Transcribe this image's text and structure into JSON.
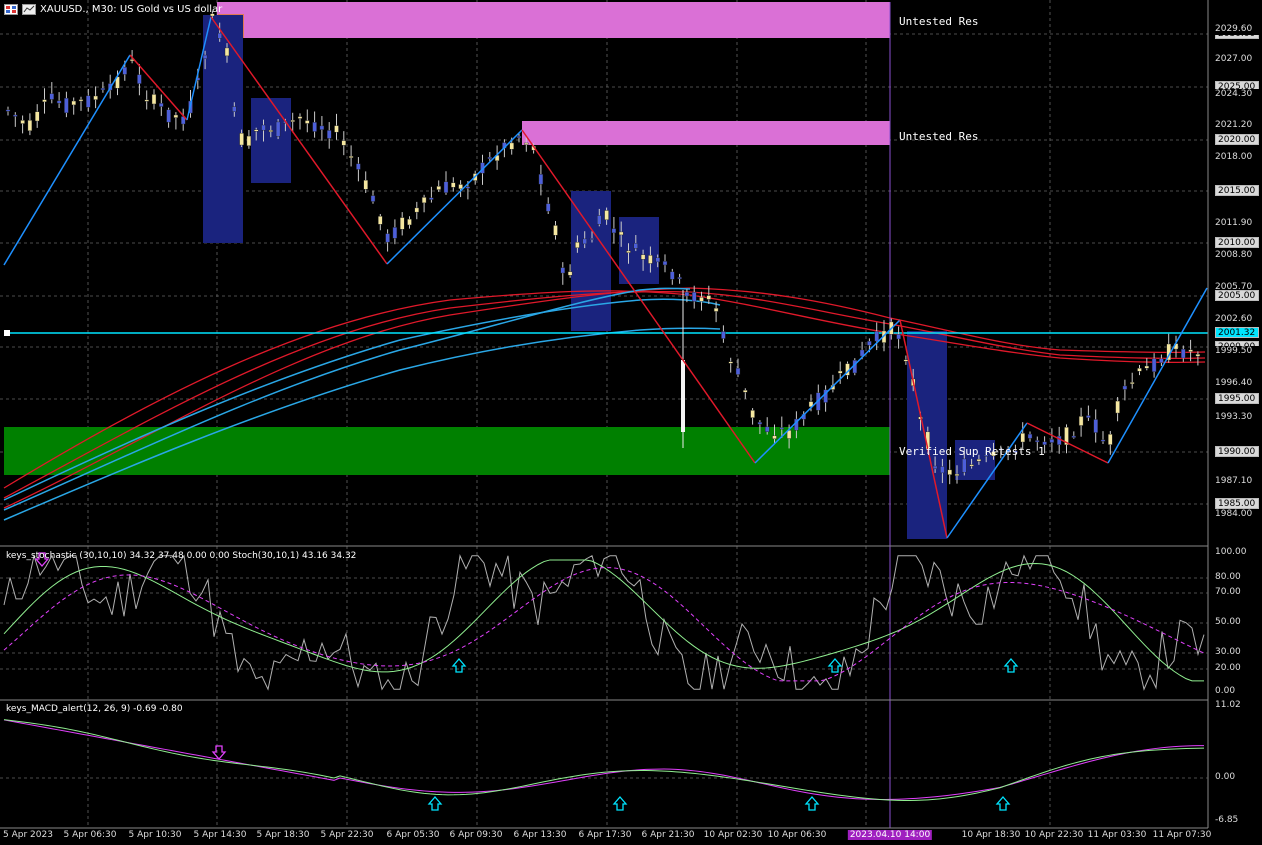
{
  "window": {
    "title": "XAUUSD., M30: US Gold vs US dollar"
  },
  "zones": [
    {
      "label": "Untested Res"
    },
    {
      "label": "Untested Res"
    },
    {
      "label": "Verified Sup Retests 1"
    }
  ],
  "price_axis": [
    {
      "value": "2030.00",
      "style": "box"
    },
    {
      "value": "2029.60",
      "style": "plain"
    },
    {
      "value": "2027.00",
      "style": "plain"
    },
    {
      "value": "2025.00",
      "style": "box"
    },
    {
      "value": "2024.30",
      "style": "plain"
    },
    {
      "value": "2021.20",
      "style": "plain"
    },
    {
      "value": "2020.00",
      "style": "box"
    },
    {
      "value": "2018.00",
      "style": "plain"
    },
    {
      "value": "2015.00",
      "style": "box"
    },
    {
      "value": "2011.90",
      "style": "plain"
    },
    {
      "value": "2010.00",
      "style": "box"
    },
    {
      "value": "2008.80",
      "style": "plain"
    },
    {
      "value": "2005.70",
      "style": "plain"
    },
    {
      "value": "2005.00",
      "style": "box"
    },
    {
      "value": "2002.60",
      "style": "plain"
    },
    {
      "value": "2001.32",
      "style": "cyan"
    },
    {
      "value": "2000.00",
      "style": "box"
    },
    {
      "value": "1999.50",
      "style": "plain"
    },
    {
      "value": "1996.40",
      "style": "plain"
    },
    {
      "value": "1995.00",
      "style": "box"
    },
    {
      "value": "1993.30",
      "style": "plain"
    },
    {
      "value": "1990.00",
      "style": "box"
    },
    {
      "value": "1987.10",
      "style": "plain"
    },
    {
      "value": "1985.00",
      "style": "box"
    },
    {
      "value": "1984.00",
      "style": "plain"
    }
  ],
  "stochastic": {
    "label": "keys_stochastic (30,10,10) 34.32 37.48 0.00 0.00 Stoch(30,10,1) 43.16 34.32",
    "levels": [
      "100.00",
      "80.00",
      "70.00",
      "50.00",
      "30.00",
      "20.00",
      "0.00"
    ]
  },
  "macd": {
    "label": "keys_MACD_alert(12, 26, 9) -0.69 -0.80",
    "levels": [
      "11.02",
      "0.00",
      "-6.85"
    ]
  },
  "time_axis": [
    "5 Apr 2023",
    "5 Apr 06:30",
    "5 Apr 10:30",
    "5 Apr 14:30",
    "5 Apr 18:30",
    "5 Apr 22:30",
    "6 Apr 05:30",
    "6 Apr 09:30",
    "6 Apr 13:30",
    "6 Apr 17:30",
    "6 Apr 21:30",
    "10 Apr 02:30",
    "10 Apr 06:30",
    "2023.04.10 14:00",
    "10 Apr 18:30",
    "10 Apr 22:30",
    "11 Apr 03:30",
    "11 Apr 07:30"
  ],
  "colors": {
    "background": "#000000",
    "bull_candle": "#f5e7a0",
    "bear_candle": "#4d5fd9",
    "resistance_zone": "#da70d6",
    "support_zone": "#008000",
    "zigzag_up": "#1e90ff",
    "zigzag_down": "#e0192a",
    "ma_red": "#e0192a",
    "ma_blue": "#2aa7e6",
    "current_price_line": "#00e5ff",
    "order_block": "#1a237e",
    "stoch_main": "#b0b0b0",
    "stoch_signal": "#90ee90",
    "macd_main": "#e040fb",
    "macd_signal": "#90ee90",
    "arrow_up": "#00e5ff",
    "arrow_down": "#e040fb"
  }
}
